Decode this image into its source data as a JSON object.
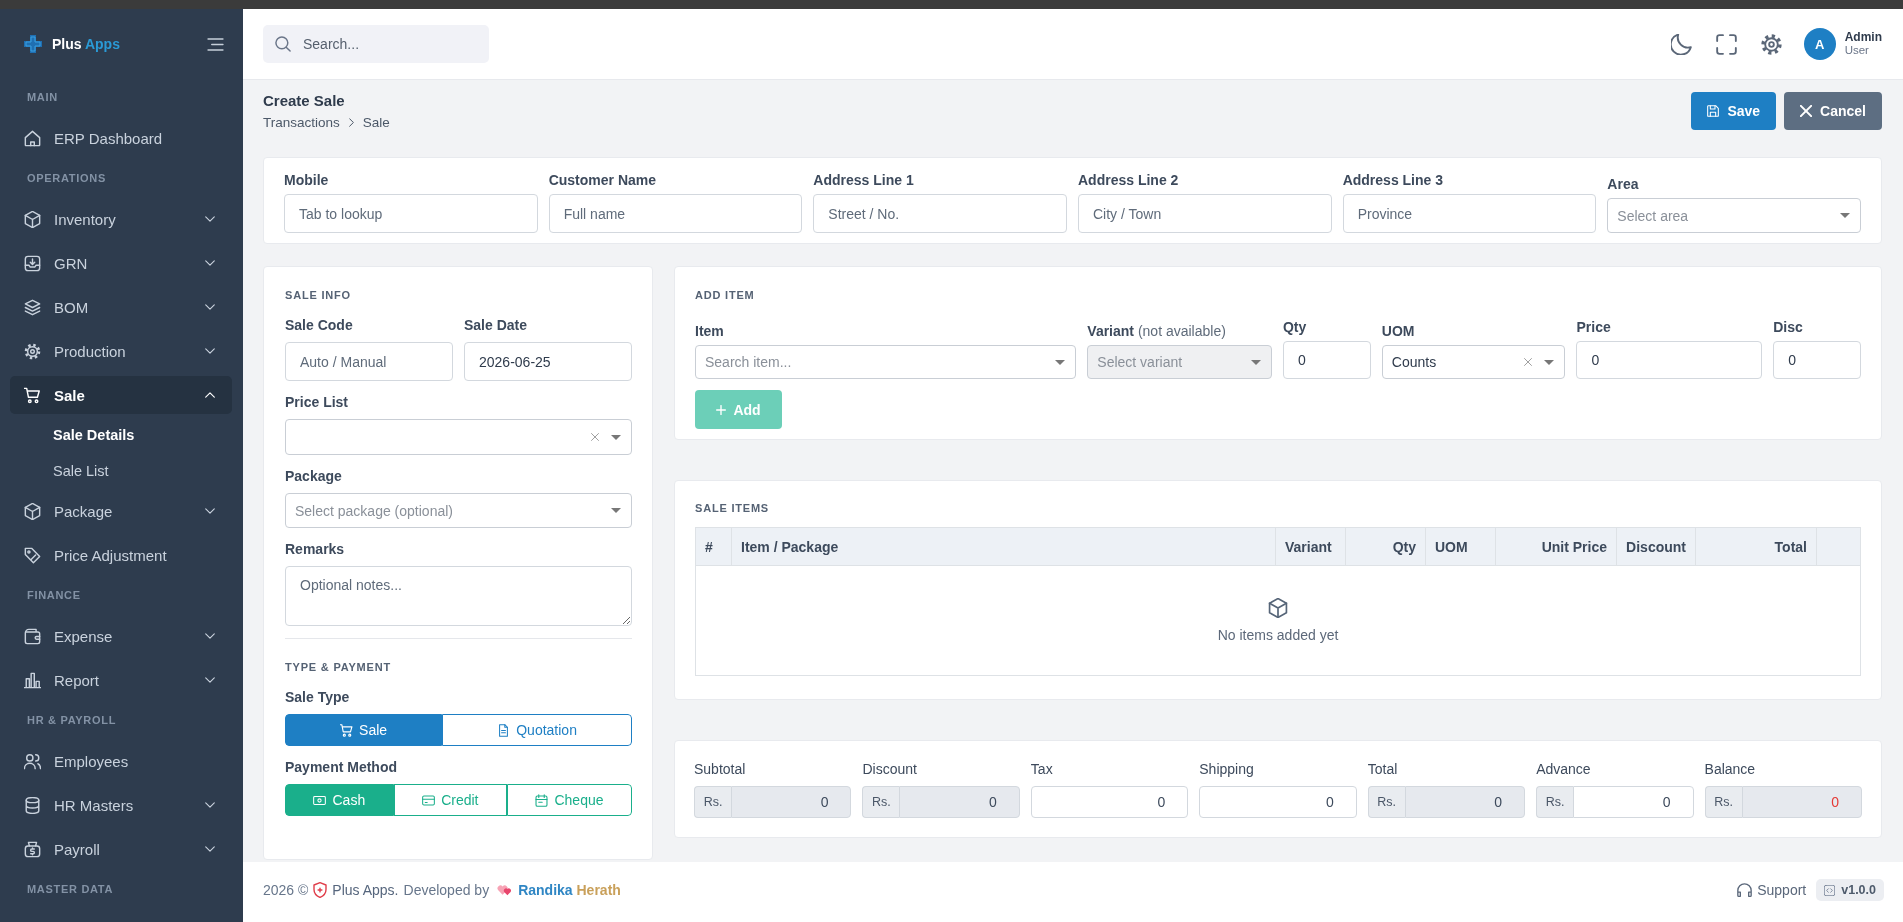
{
  "sidebar": {
    "brand": {
      "name": "Plus",
      "accent": "Apps"
    },
    "sections": [
      {
        "heading": "MAIN",
        "items": [
          {
            "label": "ERP Dashboard",
            "kind": "link",
            "selected": false
          }
        ]
      },
      {
        "heading": "OPERATIONS",
        "items": [
          {
            "label": "Inventory",
            "kind": "group",
            "selected": false,
            "expanded": false
          },
          {
            "label": "GRN",
            "kind": "group",
            "selected": false,
            "expanded": false
          },
          {
            "label": "BOM",
            "kind": "group",
            "selected": false,
            "expanded": false
          },
          {
            "label": "Production",
            "kind": "group",
            "selected": false,
            "expanded": false
          },
          {
            "label": "Sale",
            "kind": "group",
            "selected": true,
            "expanded": true,
            "children": [
              {
                "label": "Sale Details",
                "selected": true
              },
              {
                "label": "Sale List",
                "selected": false
              }
            ]
          },
          {
            "label": "Package",
            "kind": "group",
            "selected": false,
            "expanded": false
          },
          {
            "label": "Price Adjustment",
            "kind": "link",
            "selected": false
          }
        ]
      },
      {
        "heading": "FINANCE",
        "items": [
          {
            "label": "Expense",
            "kind": "group",
            "selected": false,
            "expanded": false
          },
          {
            "label": "Report",
            "kind": "group",
            "selected": false,
            "expanded": false
          }
        ]
      },
      {
        "heading": "HR & PAYROLL",
        "items": [
          {
            "label": "Employees",
            "kind": "link",
            "selected": false
          },
          {
            "label": "HR Masters",
            "kind": "group",
            "selected": false,
            "expanded": false
          },
          {
            "label": "Payroll",
            "kind": "group",
            "selected": false,
            "expanded": false
          }
        ]
      },
      {
        "heading": "MASTER DATA"
      }
    ]
  },
  "topbar": {
    "search": {
      "placeholder": "Search..."
    },
    "user": {
      "initial": "A",
      "name": "Admin",
      "role": "User"
    }
  },
  "page": {
    "title": "Create Sale",
    "breadcrumb": [
      "Transactions",
      "Sale"
    ],
    "actions": [
      {
        "label": "Save",
        "kind": "primary"
      },
      {
        "label": "Cancel",
        "kind": "secondary"
      }
    ]
  },
  "customer": {
    "fields": [
      {
        "label": "Mobile",
        "kind": "input",
        "placeholder": "Tab to lookup"
      },
      {
        "label": "Customer Name",
        "kind": "input",
        "placeholder": "Full name"
      },
      {
        "label": "Address Line 1",
        "kind": "input",
        "placeholder": "Street / No."
      },
      {
        "label": "Address Line 2",
        "kind": "input",
        "placeholder": "City / Town"
      },
      {
        "label": "Address Line 3",
        "kind": "input",
        "placeholder": "Province"
      },
      {
        "label": "Area",
        "kind": "select",
        "placeholder": "Select area"
      }
    ]
  },
  "sale_info": {
    "title": "SALE INFO",
    "code": {
      "label": "Sale Code",
      "placeholder": "Auto / Manual"
    },
    "date": {
      "label": "Sale Date",
      "value": "2026-06-25"
    },
    "price_list": {
      "label": "Price List",
      "clearable": true
    },
    "package": {
      "label": "Package",
      "placeholder": "Select package (optional)"
    },
    "remarks": {
      "label": "Remarks",
      "placeholder": "Optional notes..."
    },
    "payment_title": "TYPE & PAYMENT",
    "sale_type": {
      "label": "Sale Type",
      "options": [
        {
          "label": "Sale",
          "selected": true
        },
        {
          "label": "Quotation",
          "selected": false
        }
      ]
    },
    "payment_method": {
      "label": "Payment Method",
      "options": [
        {
          "label": "Cash",
          "selected": true
        },
        {
          "label": "Credit",
          "selected": false
        },
        {
          "label": "Cheque",
          "selected": false
        }
      ]
    }
  },
  "add_item": {
    "title": "ADD ITEM",
    "fields": [
      {
        "kind": "select",
        "label": "Item",
        "placeholder": "Search item...",
        "disabled": false,
        "clearable": false
      },
      {
        "kind": "select",
        "label": "Variant",
        "note": "(not available)",
        "placeholder": "Select variant",
        "disabled": true,
        "clearable": false
      },
      {
        "kind": "input",
        "label": "Qty",
        "value": "0"
      },
      {
        "kind": "select",
        "label": "UOM",
        "value": "Counts",
        "disabled": false,
        "clearable": true
      },
      {
        "kind": "input",
        "label": "Price",
        "value": "0"
      },
      {
        "kind": "input",
        "label": "Disc",
        "value": "0"
      }
    ],
    "button": {
      "label": "Add",
      "disabled": true
    }
  },
  "sale_items": {
    "title": "SALE ITEMS",
    "columns": [
      "#",
      "Item / Package",
      "Variant",
      "Qty",
      "UOM",
      "Unit Price",
      "Discount",
      "Total"
    ],
    "empty_message": "No items added yet"
  },
  "totals": [
    {
      "label": "Subtotal",
      "prefix": "Rs.",
      "value": "0",
      "readonly": true
    },
    {
      "label": "Discount",
      "prefix": "Rs.",
      "value": "0",
      "readonly": true
    },
    {
      "label": "Tax",
      "value": "0",
      "readonly": false
    },
    {
      "label": "Shipping",
      "value": "0",
      "readonly": false
    },
    {
      "label": "Total",
      "prefix": "Rs.",
      "value": "0",
      "readonly": true
    },
    {
      "label": "Advance",
      "prefix": "Rs.",
      "value": "0",
      "readonly": false
    },
    {
      "label": "Balance",
      "prefix": "Rs.",
      "value": "0",
      "readonly": true,
      "color": "#e53935"
    }
  ],
  "footer": {
    "copyright": "2026 ©",
    "brand": "Plus Apps.",
    "credit": "Developed by",
    "author": {
      "first": "Randika",
      "last": "Herath"
    },
    "support": "Support",
    "version": "v1.0.0"
  }
}
